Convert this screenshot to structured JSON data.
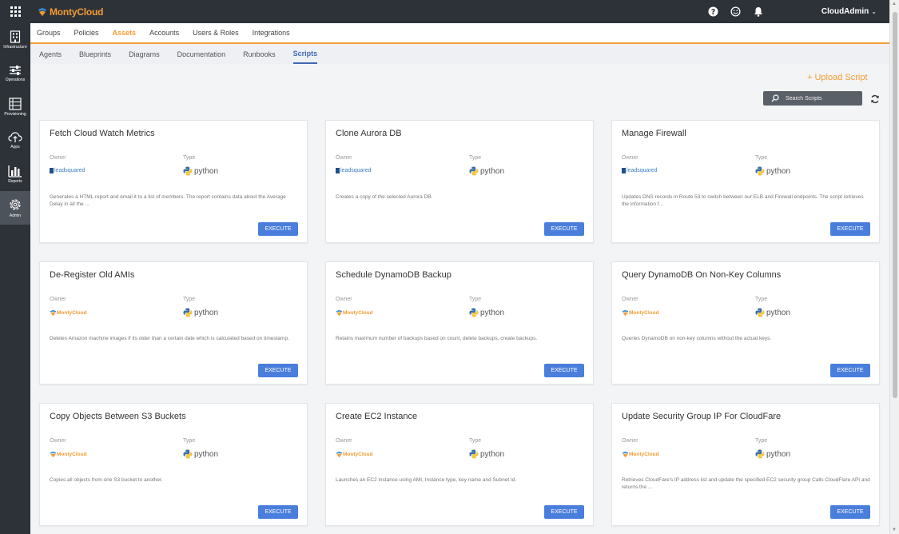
{
  "app": {
    "brand": "MontyCloud",
    "user": "CloudAdmin"
  },
  "sidebar": {
    "items": [
      {
        "label": "Infrastructure",
        "icon": "infrastructure-icon"
      },
      {
        "label": "Operations",
        "icon": "sliders-icon"
      },
      {
        "label": "Provisioning",
        "icon": "provisioning-icon"
      },
      {
        "label": "Apps",
        "icon": "cloud-upload-icon"
      },
      {
        "label": "Reports",
        "icon": "bar-chart-icon"
      },
      {
        "label": "Admin",
        "icon": "gear-icon"
      }
    ],
    "active": "Admin"
  },
  "nav": {
    "primary": [
      "Groups",
      "Policies",
      "Assets",
      "Accounts",
      "Users & Roles",
      "Integrations"
    ],
    "primary_active": "Assets",
    "secondary": [
      "Agents",
      "Blueprints",
      "Diagrams",
      "Documentation",
      "Runbooks",
      "Scripts"
    ],
    "secondary_active": "Scripts"
  },
  "actions": {
    "upload_label": "+ Upload Script",
    "search_placeholder": "Search Scripts"
  },
  "labels": {
    "owner": "Owner",
    "type": "Type",
    "execute": "EXECUTE"
  },
  "scripts": [
    {
      "title": "Fetch Cloud Watch Metrics",
      "owner": "leadsquared",
      "type": "python",
      "description": "Generates a HTML report and email it to a list of members. The report contains data about the Average Delay in all the ..."
    },
    {
      "title": "Clone Aurora DB",
      "owner": "leadsquared",
      "type": "python",
      "description": "Creates a copy of the selected Aurora DB."
    },
    {
      "title": "Manage Firewall",
      "owner": "leadsquared",
      "type": "python",
      "description": "Updates DNS records in Route 53 to switch between our ELB and Firewall endpoints. The script retrieves the information f..."
    },
    {
      "title": "De-Register Old AMIs",
      "owner": "MontyCloud",
      "type": "python",
      "description": "Deletes Amazon machine images if its older than a certain date which is calculated based on timestamp."
    },
    {
      "title": "Schedule DynamoDB Backup",
      "owner": "MontyCloud",
      "type": "python",
      "description": "Retains maximum number of backups based on count, delete backups, create backups."
    },
    {
      "title": "Query DynamoDB On Non-Key Columns",
      "owner": "MontyCloud",
      "type": "python",
      "description": "Queries DynamoDB on non-key columns without the actual keys."
    },
    {
      "title": "Copy Objects Between S3 Buckets",
      "owner": "MontyCloud",
      "type": "python",
      "description": "Copies all objects from one S3 bucket to another."
    },
    {
      "title": "Create EC2 Instance",
      "owner": "MontyCloud",
      "type": "python",
      "description": "Launches an EC2 instance using AMI, Instance type, key name and Subnet Id."
    },
    {
      "title": "Update Security Group IP For CloudFare",
      "owner": "MontyCloud",
      "type": "python",
      "description": "Retrieves CloudFare's IP address list and update the specified EC2 security group Calls CloudFlare API and returns the ..."
    }
  ]
}
